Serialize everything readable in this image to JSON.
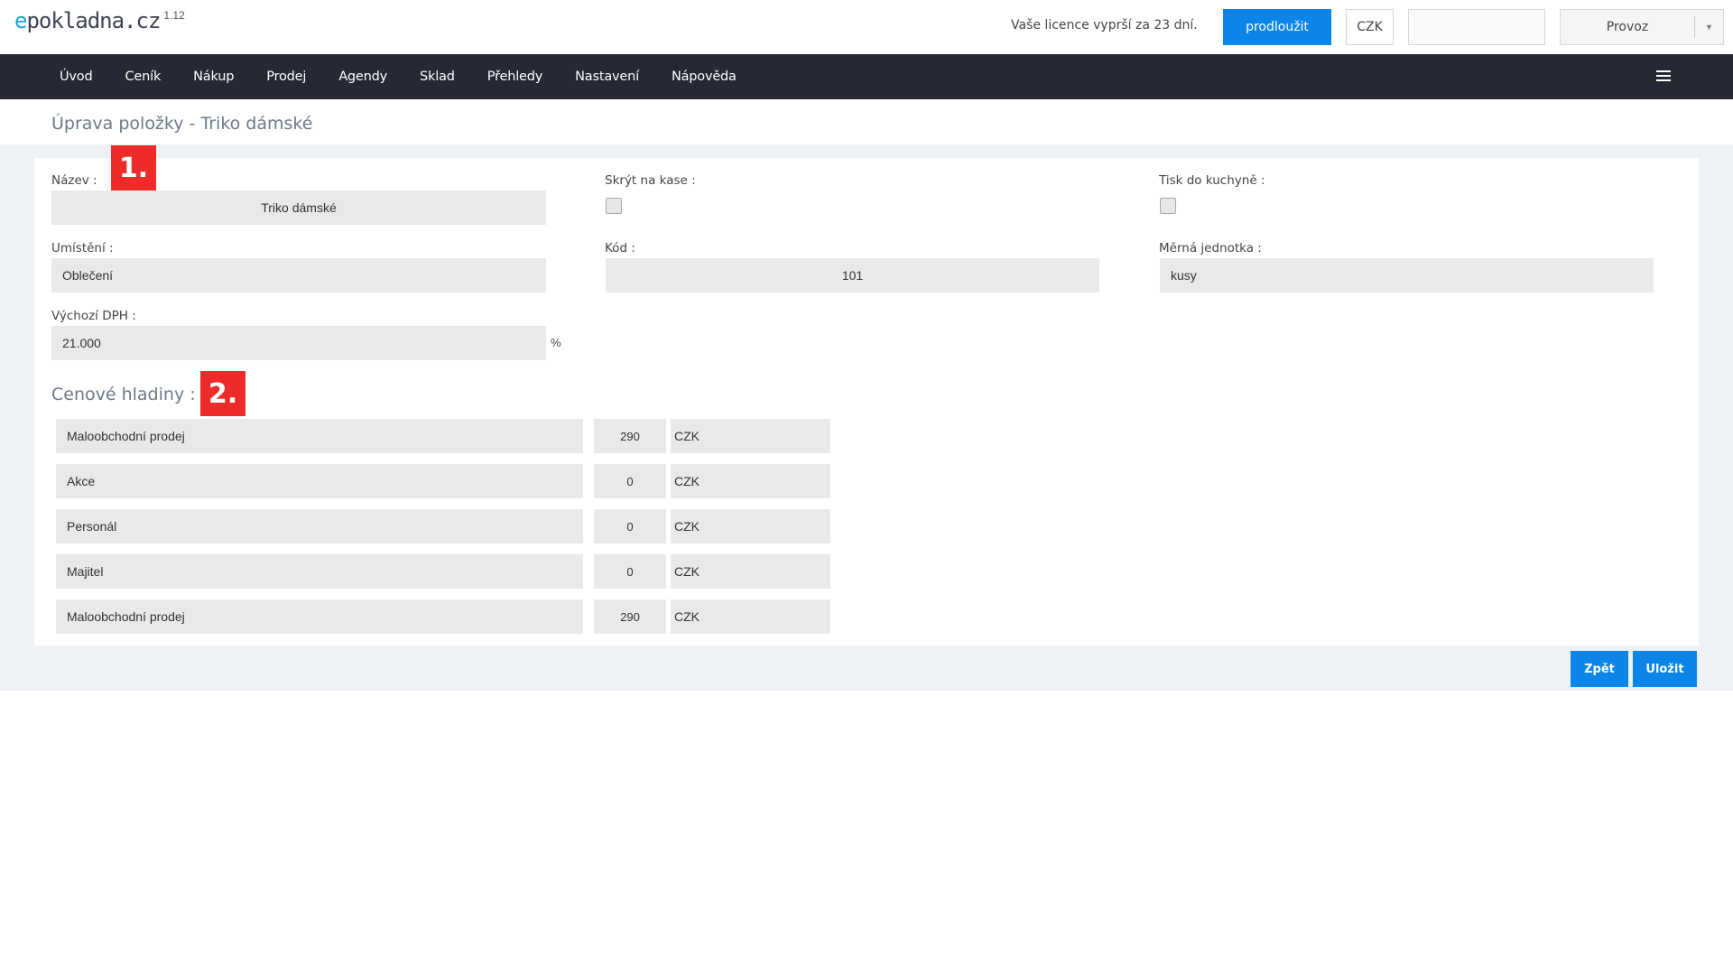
{
  "header": {
    "logo_text": "epokladna.cz",
    "version": "1.12",
    "license_notice": "Vaše licence vyprší za 23 dní.",
    "renew_label": "prodloužit",
    "currency": "CZK",
    "blank_field": "",
    "location_select": "Provoz"
  },
  "nav": {
    "items": [
      "Úvod",
      "Ceník",
      "Nákup",
      "Prodej",
      "Agendy",
      "Sklad",
      "Přehledy",
      "Nastavení",
      "Nápověda"
    ]
  },
  "page": {
    "title": "Úprava položky - Triko dámské"
  },
  "form": {
    "name_label": "Název :",
    "name_value": "Triko dámské",
    "hide_label": "Skrýt na kase :",
    "kitchen_label": "Tisk do kuchyně :",
    "location_label": "Umístění :",
    "location_value": "Oblečení",
    "code_label": "Kód :",
    "code_value": "101",
    "unit_label": "Měrná jednotka :",
    "unit_value": "kusy",
    "vat_label": "Výchozí DPH :",
    "vat_value": "21.000",
    "vat_unit": "%"
  },
  "badges": {
    "first": "1.",
    "second": "2."
  },
  "price_levels": {
    "title": "Cenové hladiny :",
    "rows": [
      {
        "name": "Maloobchodní prodej",
        "value": "290",
        "currency": "CZK"
      },
      {
        "name": "Akce",
        "value": "0",
        "currency": "CZK"
      },
      {
        "name": "Personál",
        "value": "0",
        "currency": "CZK"
      },
      {
        "name": "Majitel",
        "value": "0",
        "currency": "CZK"
      },
      {
        "name": "Maloobchodní prodej",
        "value": "290",
        "currency": "CZK"
      }
    ]
  },
  "actions": {
    "back_label": "Zpět",
    "save_label": "Uložit"
  },
  "colors": {
    "accent": "#0b86e8",
    "navbar": "#262833",
    "badge": "#ee2b2b"
  }
}
